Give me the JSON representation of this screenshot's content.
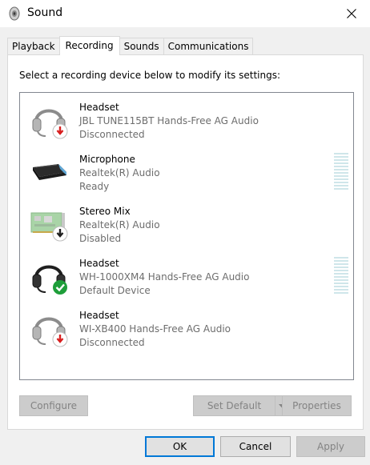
{
  "window": {
    "title": "Sound"
  },
  "tabs": [
    {
      "label": "Playback",
      "active": false
    },
    {
      "label": "Recording",
      "active": true
    },
    {
      "label": "Sounds",
      "active": false
    },
    {
      "label": "Communications",
      "active": false
    }
  ],
  "instructions": "Select a recording device below to modify its settings:",
  "devices": [
    {
      "name": "Headset",
      "description": "JBL TUNE115BT Hands-Free AG Audio",
      "status": "Disconnected",
      "icon": "headset-disconnected-icon",
      "has_level_meter": false
    },
    {
      "name": "Microphone",
      "description": "Realtek(R) Audio",
      "status": "Ready",
      "icon": "microphone-icon",
      "has_level_meter": true
    },
    {
      "name": "Stereo Mix",
      "description": "Realtek(R) Audio",
      "status": "Disabled",
      "icon": "sound-card-disabled-icon",
      "has_level_meter": false
    },
    {
      "name": "Headset",
      "description": "WH-1000XM4 Hands-Free AG Audio",
      "status": "Default Device",
      "icon": "headset-default-icon",
      "has_level_meter": true
    },
    {
      "name": "Headset",
      "description": "WI-XB400 Hands-Free AG Audio",
      "status": "Disconnected",
      "icon": "headset-disconnected-icon",
      "has_level_meter": false
    }
  ],
  "buttons": {
    "configure": "Configure",
    "set_default": "Set Default",
    "properties": "Properties",
    "ok": "OK",
    "cancel": "Cancel",
    "apply": "Apply"
  },
  "colors": {
    "accent": "#0078d7",
    "default_check": "#1e9e3a",
    "disconnected_arrow": "#d81e1e"
  }
}
